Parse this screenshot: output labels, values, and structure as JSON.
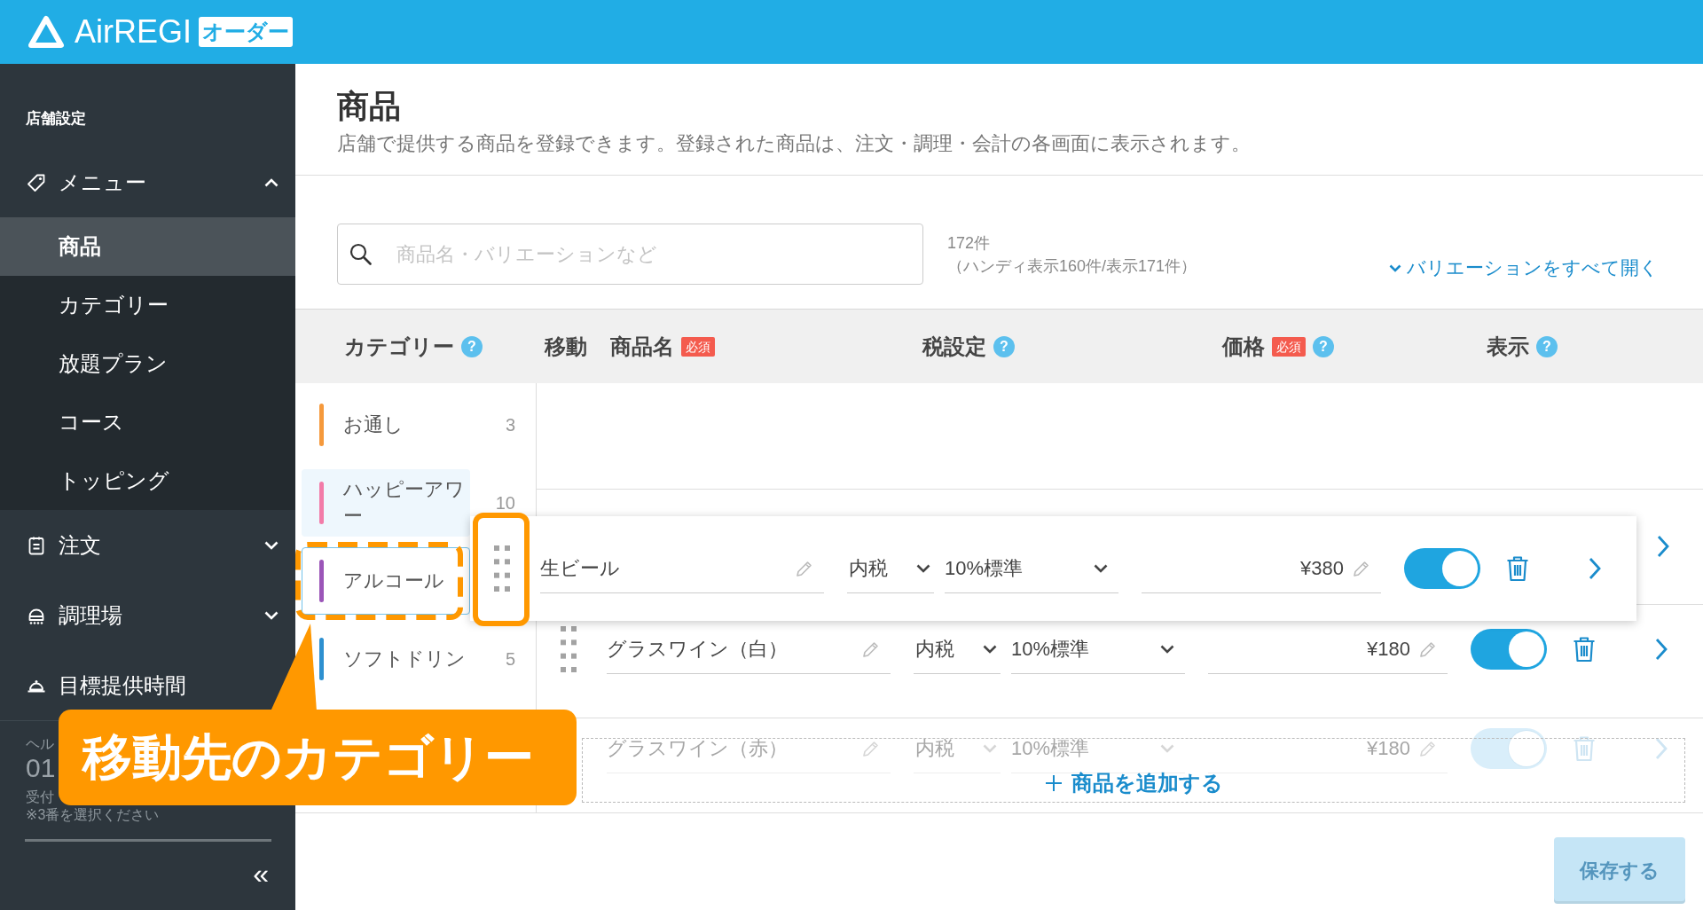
{
  "header": {
    "logo": "AirREGI",
    "badge": "オーダー"
  },
  "sidebar": {
    "section": "店舗設定",
    "groups": [
      {
        "label": "メニュー",
        "expanded": true,
        "children": [
          {
            "label": "商品",
            "selected": true
          },
          {
            "label": "カテゴリー",
            "selected": false
          },
          {
            "label": "放題プラン",
            "selected": false
          },
          {
            "label": "コース",
            "selected": false
          },
          {
            "label": "トッピング",
            "selected": false
          }
        ]
      },
      {
        "label": "注文",
        "expanded": false
      },
      {
        "label": "調理場",
        "expanded": false
      },
      {
        "label": "目標提供時間"
      }
    ],
    "help": {
      "title": "ヘル",
      "phone": "01",
      "hours": "受付",
      "note": "※3番を選択ください"
    },
    "collapse": "«"
  },
  "page": {
    "title": "商品",
    "description": "店舗で提供する商品を登録できます。登録された商品は、注文・調理・会計の各画面に表示されます。"
  },
  "search": {
    "placeholder": "商品名・バリエーションなど"
  },
  "counts": {
    "total": "172件",
    "detail": "（ハンディ表示160件/表示171件）"
  },
  "expand_all_link": "バリエーションをすべて開く",
  "table": {
    "columns": [
      {
        "label": "カテゴリー",
        "help": "?"
      },
      {
        "label": "移動"
      },
      {
        "label": "商品名",
        "badge": "必須"
      },
      {
        "label": "税設定",
        "help": "?"
      },
      {
        "label": "価格",
        "badge": "必須",
        "help": "?"
      },
      {
        "label": "表示",
        "help": "?"
      }
    ],
    "categories": [
      {
        "name": "お通し",
        "count": "3",
        "color": "#f5993c",
        "selected": false,
        "drop_target": false,
        "highlighted": false
      },
      {
        "name": "ハッピーアワー",
        "count": "10",
        "color": "#f27ba8",
        "selected": true,
        "drop_target": false,
        "highlighted": false
      },
      {
        "name": "アルコール",
        "color": "#9b55b8",
        "selected": false,
        "drop_target": true,
        "highlighted": true
      },
      {
        "name": "ソフトドリン",
        "count": "5",
        "color": "#2e90d0",
        "selected": false,
        "drop_target": false,
        "highlighted": false
      }
    ],
    "products": [
      {
        "name": "生ビール",
        "tax_type": "内税",
        "tax_rate": "10%標準",
        "price": "¥380",
        "visible": true,
        "dragging": true,
        "handle_highlighted": true,
        "faded": false
      },
      {
        "name": "グラスワイン（白）",
        "tax_type": "内税",
        "tax_rate": "10%標準",
        "price": "¥180",
        "visible": true,
        "dragging": false,
        "handle_highlighted": false,
        "faded": false
      },
      {
        "name": "グラスワイン（赤）",
        "tax_type": "内税",
        "tax_rate": "10%標準",
        "price": "¥180",
        "visible": true,
        "dragging": false,
        "handle_highlighted": false,
        "faded": true
      }
    ]
  },
  "add_button": "商品を追加する",
  "save_button": {
    "label": "保存する",
    "disabled": true
  },
  "callout": {
    "text": "移動先のカテゴリー"
  }
}
